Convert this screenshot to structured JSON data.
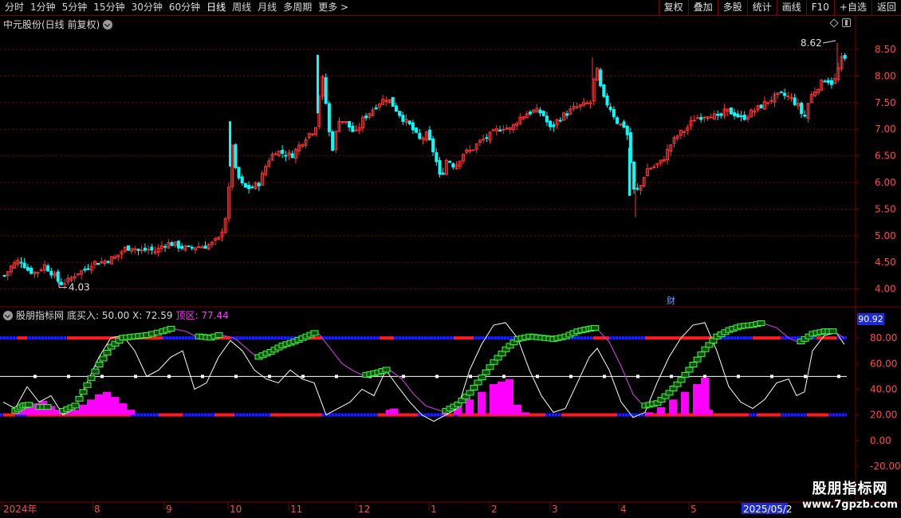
{
  "toolbar": {
    "periods": [
      "分时",
      "1分钟",
      "5分钟",
      "15分钟",
      "30分钟",
      "60分钟",
      "日线",
      "周线",
      "月线",
      "多周期",
      "更多 >"
    ],
    "active": "日线",
    "buttons": [
      "复权",
      "叠加",
      "多股",
      "统计",
      "画线",
      "F10",
      "+自选",
      "返回"
    ]
  },
  "main_chart": {
    "title": "中元股份(日线 前复权)",
    "high_label": "8.62",
    "low_label": "4.03",
    "event_marker": "财",
    "y_ticks": [
      "8.50",
      "8.00",
      "7.50",
      "7.00",
      "6.50",
      "6.00",
      "5.50",
      "5.00",
      "4.50",
      "4.00"
    ]
  },
  "indicator": {
    "name": "股朋指标网",
    "buy_text": "底买入: 50.00  X: 72.59",
    "top_text": "顶区: 77.44",
    "current_value": "90.92",
    "y_ticks": [
      "80.00",
      "60.00",
      "40.00",
      "20.00",
      "0.00",
      "-20.00"
    ]
  },
  "x_axis": {
    "labels": [
      "2024年",
      "8",
      "9",
      "10",
      "11",
      "12",
      "1",
      "2",
      "3",
      "4",
      "5",
      "2025/05/2"
    ]
  },
  "watermark": {
    "line1": "股朋指标网",
    "line2": "www.7gpzb.com"
  },
  "colors": {
    "up": "#ff3333",
    "down": "#00ffff",
    "grid": "#7a0000",
    "magenta": "#ff00ff",
    "green": "#33ff33",
    "blue_band": "#1e1eff",
    "red_band": "#ff1a1a"
  },
  "chart_data": [
    {
      "type": "candlestick",
      "title": "中元股份(日线 前复权)",
      "ylim": [
        3.8,
        8.8
      ],
      "close_path": [
        [
          0,
          4.25
        ],
        [
          10,
          4.45
        ],
        [
          20,
          4.55
        ],
        [
          30,
          4.35
        ],
        [
          40,
          4.3
        ],
        [
          50,
          4.45
        ],
        [
          60,
          4.3
        ],
        [
          70,
          4.1
        ],
        [
          80,
          4.15
        ],
        [
          90,
          4.3
        ],
        [
          100,
          4.35
        ],
        [
          110,
          4.5
        ],
        [
          120,
          4.5
        ],
        [
          130,
          4.55
        ],
        [
          140,
          4.6
        ],
        [
          150,
          4.75
        ],
        [
          160,
          4.8
        ],
        [
          170,
          4.7
        ],
        [
          180,
          4.75
        ],
        [
          190,
          4.7
        ],
        [
          200,
          4.85
        ],
        [
          210,
          4.85
        ],
        [
          220,
          4.8
        ],
        [
          230,
          4.75
        ],
        [
          240,
          4.8
        ],
        [
          250,
          4.8
        ],
        [
          260,
          4.85
        ],
        [
          270,
          4.95
        ],
        [
          280,
          5.5
        ],
        [
          285,
          6.8
        ],
        [
          290,
          6.2
        ],
        [
          300,
          5.9
        ],
        [
          310,
          5.9
        ],
        [
          320,
          6.0
        ],
        [
          330,
          6.4
        ],
        [
          340,
          6.6
        ],
        [
          350,
          6.55
        ],
        [
          360,
          6.5
        ],
        [
          370,
          6.7
        ],
        [
          380,
          6.9
        ],
        [
          390,
          7.0
        ],
        [
          398,
          8.05
        ],
        [
          405,
          7.3
        ],
        [
          410,
          6.55
        ],
        [
          420,
          7.2
        ],
        [
          430,
          7.1
        ],
        [
          440,
          6.9
        ],
        [
          450,
          7.2
        ],
        [
          460,
          7.35
        ],
        [
          470,
          7.5
        ],
        [
          480,
          7.6
        ],
        [
          490,
          7.4
        ],
        [
          500,
          7.2
        ],
        [
          510,
          7.05
        ],
        [
          520,
          6.8
        ],
        [
          530,
          6.9
        ],
        [
          540,
          6.5
        ],
        [
          547,
          6.05
        ],
        [
          555,
          6.45
        ],
        [
          565,
          6.3
        ],
        [
          575,
          6.55
        ],
        [
          585,
          6.6
        ],
        [
          595,
          6.75
        ],
        [
          605,
          6.85
        ],
        [
          615,
          6.95
        ],
        [
          625,
          7.05
        ],
        [
          635,
          7.0
        ],
        [
          645,
          7.2
        ],
        [
          655,
          7.3
        ],
        [
          665,
          7.35
        ],
        [
          675,
          7.3
        ],
        [
          685,
          7.0
        ],
        [
          695,
          7.2
        ],
        [
          705,
          7.3
        ],
        [
          715,
          7.4
        ],
        [
          725,
          7.45
        ],
        [
          735,
          7.5
        ],
        [
          742,
          8.2
        ],
        [
          750,
          7.6
        ],
        [
          760,
          7.4
        ],
        [
          770,
          7.1
        ],
        [
          780,
          7.05
        ],
        [
          790,
          5.8
        ],
        [
          797,
          5.9
        ],
        [
          805,
          6.25
        ],
        [
          815,
          6.3
        ],
        [
          825,
          6.4
        ],
        [
          835,
          6.7
        ],
        [
          845,
          6.9
        ],
        [
          855,
          7.0
        ],
        [
          865,
          7.2
        ],
        [
          875,
          7.25
        ],
        [
          885,
          7.3
        ],
        [
          895,
          7.2
        ],
        [
          905,
          7.35
        ],
        [
          915,
          7.3
        ],
        [
          925,
          7.2
        ],
        [
          935,
          7.3
        ],
        [
          945,
          7.4
        ],
        [
          955,
          7.5
        ],
        [
          965,
          7.6
        ],
        [
          975,
          7.65
        ],
        [
          985,
          7.6
        ],
        [
          995,
          7.45
        ],
        [
          1003,
          7.2
        ],
        [
          1010,
          7.6
        ],
        [
          1020,
          7.8
        ],
        [
          1030,
          7.95
        ],
        [
          1040,
          7.85
        ],
        [
          1045,
          8.1
        ],
        [
          1052,
          8.4
        ],
        [
          1058,
          8.15
        ]
      ],
      "high": 8.62,
      "low": 4.03,
      "x_labels": [
        "2024年",
        "8",
        "9",
        "10",
        "11",
        "12",
        "1",
        "2",
        "3",
        "4",
        "5",
        "2025/05/2"
      ]
    },
    {
      "type": "line",
      "title": "股朋指标网",
      "ylim": [
        -25,
        95
      ],
      "reference_lines": [
        80,
        50,
        20
      ],
      "series": [
        {
          "color": "#ffffff",
          "points": [
            [
              0,
              30
            ],
            [
              15,
              25
            ],
            [
              30,
              42
            ],
            [
              45,
              30
            ],
            [
              60,
              35
            ],
            [
              75,
              20
            ],
            [
              90,
              25
            ],
            [
              105,
              45
            ],
            [
              120,
              65
            ],
            [
              135,
              80
            ],
            [
              150,
              82
            ],
            [
              165,
              70
            ],
            [
              180,
              50
            ],
            [
              195,
              55
            ],
            [
              210,
              65
            ],
            [
              225,
              70
            ],
            [
              240,
              40
            ],
            [
              255,
              45
            ],
            [
              270,
              65
            ],
            [
              285,
              78
            ],
            [
              300,
              70
            ],
            [
              315,
              55
            ],
            [
              330,
              48
            ],
            [
              345,
              45
            ],
            [
              360,
              55
            ],
            [
              375,
              48
            ],
            [
              390,
              45
            ],
            [
              405,
              20
            ],
            [
              420,
              25
            ],
            [
              435,
              30
            ],
            [
              450,
              40
            ],
            [
              465,
              35
            ],
            [
              480,
              55
            ],
            [
              495,
              42
            ],
            [
              510,
              30
            ],
            [
              525,
              20
            ],
            [
              540,
              15
            ],
            [
              555,
              20
            ],
            [
              570,
              25
            ],
            [
              585,
              55
            ],
            [
              600,
              75
            ],
            [
              615,
              90
            ],
            [
              630,
              92
            ],
            [
              645,
              80
            ],
            [
              660,
              55
            ],
            [
              675,
              35
            ],
            [
              690,
              22
            ],
            [
              705,
              25
            ],
            [
              720,
              45
            ],
            [
              735,
              65
            ],
            [
              745,
              72
            ],
            [
              760,
              55
            ],
            [
              775,
              30
            ],
            [
              790,
              18
            ],
            [
              805,
              22
            ],
            [
              820,
              45
            ],
            [
              835,
              65
            ],
            [
              850,
              80
            ],
            [
              865,
              90
            ],
            [
              880,
              92
            ],
            [
              895,
              70
            ],
            [
              910,
              42
            ],
            [
              925,
              30
            ],
            [
              940,
              25
            ],
            [
              955,
              32
            ],
            [
              970,
              45
            ],
            [
              985,
              48
            ],
            [
              995,
              35
            ],
            [
              1005,
              38
            ],
            [
              1015,
              70
            ],
            [
              1030,
              82
            ],
            [
              1045,
              84
            ],
            [
              1055,
              75
            ]
          ]
        },
        {
          "color": "#33ff33",
          "points": [
            [
              15,
              22
            ],
            [
              25,
              26
            ],
            [
              35,
              27
            ],
            [
              45,
              25
            ],
            [
              60,
              25
            ],
            [
              75,
              22
            ],
            [
              90,
              26
            ],
            [
              105,
              42
            ],
            [
              120,
              58
            ],
            [
              135,
              72
            ],
            [
              150,
              79
            ],
            [
              165,
              80
            ],
            [
              180,
              81
            ],
            [
              200,
              84
            ],
            [
              215,
              87
            ],
            [
              230,
              85
            ],
            [
              245,
              80
            ],
            [
              260,
              79
            ],
            [
              275,
              82
            ],
            [
              290,
              80
            ],
            [
              305,
              72
            ],
            [
              320,
              64
            ],
            [
              335,
              68
            ],
            [
              350,
              73
            ],
            [
              365,
              76
            ],
            [
              380,
              80
            ],
            [
              395,
              84
            ],
            [
              410,
              72
            ],
            [
              425,
              60
            ],
            [
              440,
              54
            ],
            [
              455,
              50
            ],
            [
              470,
              52
            ],
            [
              485,
              55
            ],
            [
              500,
              48
            ],
            [
              515,
              36
            ],
            [
              530,
              27
            ],
            [
              545,
              24
            ],
            [
              555,
              22
            ],
            [
              570,
              27
            ],
            [
              585,
              36
            ],
            [
              600,
              48
            ],
            [
              615,
              60
            ],
            [
              630,
              70
            ],
            [
              645,
              78
            ],
            [
              660,
              80
            ],
            [
              675,
              79
            ],
            [
              690,
              78
            ],
            [
              705,
              80
            ],
            [
              720,
              84
            ],
            [
              735,
              86
            ],
            [
              745,
              87
            ],
            [
              760,
              77
            ],
            [
              775,
              58
            ],
            [
              790,
              36
            ],
            [
              805,
              26
            ],
            [
              820,
              28
            ],
            [
              835,
              36
            ],
            [
              850,
              46
            ],
            [
              865,
              58
            ],
            [
              880,
              70
            ],
            [
              895,
              80
            ],
            [
              910,
              85
            ],
            [
              925,
              88
            ],
            [
              940,
              89
            ],
            [
              955,
              91
            ],
            [
              970,
              88
            ],
            [
              985,
              80
            ],
            [
              1000,
              76
            ],
            [
              1015,
              82
            ],
            [
              1030,
              84
            ],
            [
              1045,
              84
            ],
            [
              1055,
              80
            ]
          ]
        }
      ],
      "bars": {
        "color": "#ff00ff",
        "values": [
          [
            20,
            25
          ],
          [
            30,
            27
          ],
          [
            40,
            29
          ],
          [
            50,
            31
          ],
          [
            60,
            27
          ],
          [
            70,
            24
          ],
          [
            80,
            26
          ],
          [
            90,
            24
          ],
          [
            100,
            28
          ],
          [
            110,
            32
          ],
          [
            120,
            36
          ],
          [
            130,
            38
          ],
          [
            140,
            34
          ],
          [
            150,
            29
          ],
          [
            160,
            24
          ],
          [
            485,
            24
          ],
          [
            490,
            25
          ],
          [
            555,
            22
          ],
          [
            570,
            28
          ],
          [
            585,
            32
          ],
          [
            600,
            38
          ],
          [
            615,
            44
          ],
          [
            625,
            46
          ],
          [
            635,
            48
          ],
          [
            645,
            28
          ],
          [
            655,
            22
          ],
          [
            810,
            22
          ],
          [
            825,
            26
          ],
          [
            840,
            32
          ],
          [
            855,
            38
          ],
          [
            870,
            44
          ],
          [
            880,
            49
          ],
          [
            885,
            24
          ]
        ]
      }
    }
  ]
}
